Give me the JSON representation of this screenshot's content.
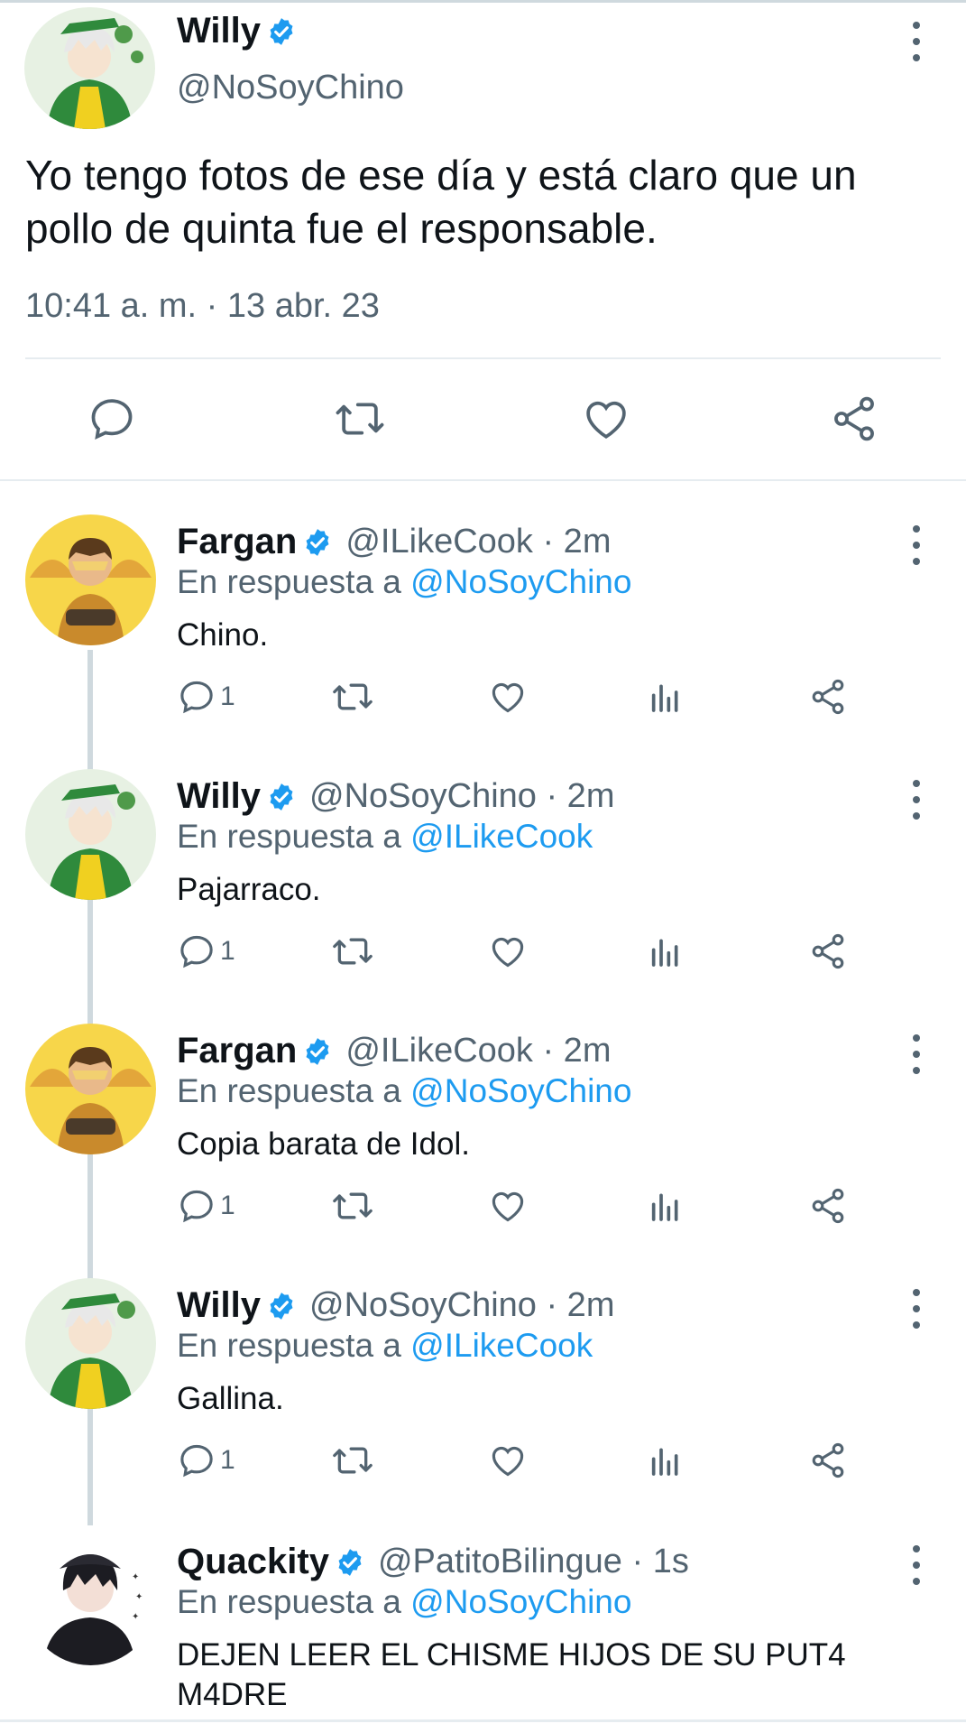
{
  "main": {
    "name": "Willy",
    "handle": "@NoSoyChino",
    "text": "Yo tengo fotos de ese día y está claro que un pollo de quinta fue el responsable.",
    "timestamp": "10:41 a. m. · 13 abr. 23",
    "actions": [
      "reply-icon",
      "retweet-icon",
      "like-icon",
      "share-icon"
    ]
  },
  "reply_prefix": "En respuesta a",
  "replies": [
    {
      "name": "Fargan",
      "handle": "@ILikeCook · 2m",
      "reply_to": "@NoSoyChino",
      "text": "Chino.",
      "reply_count": "1"
    },
    {
      "name": "Willy",
      "handle": "@NoSoyChino · 2m",
      "reply_to": "@ILikeCook",
      "text": "Pajarraco.",
      "reply_count": "1"
    },
    {
      "name": "Fargan",
      "handle": "@ILikeCook · 2m",
      "reply_to": "@NoSoyChino",
      "text": "Copia barata de Idol.",
      "reply_count": "1"
    },
    {
      "name": "Willy",
      "handle": "@NoSoyChino · 2m",
      "reply_to": "@ILikeCook",
      "text": "Gallina.",
      "reply_count": "1"
    },
    {
      "name": "Quackity",
      "handle": "@PatitoBilingue · 1s",
      "reply_to": "@NoSoyChino",
      "text": "DEJEN LEER EL CHISME HIJOS DE SU PUT4 M4DRE",
      "reply_count": ""
    }
  ],
  "colors": {
    "accent": "#1d9bf0",
    "muted": "#536471",
    "text": "#0f1419",
    "divider": "#e6ecf0"
  }
}
